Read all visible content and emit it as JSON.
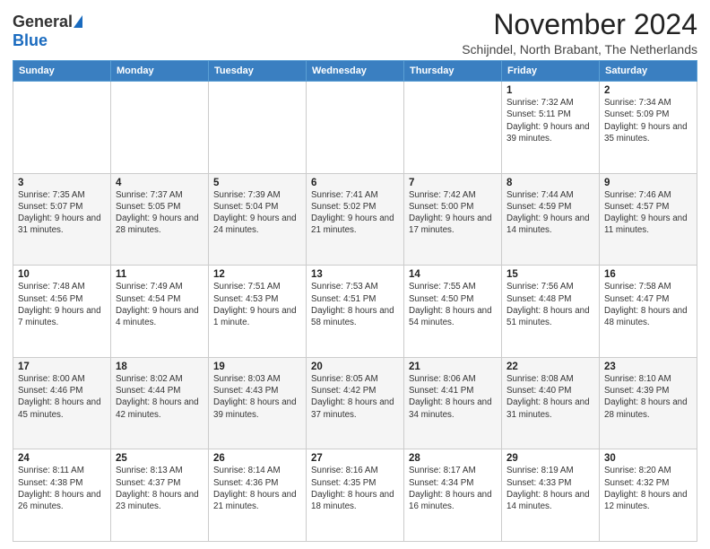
{
  "logo": {
    "general": "General",
    "blue": "Blue"
  },
  "header": {
    "month": "November 2024",
    "location": "Schijndel, North Brabant, The Netherlands"
  },
  "weekdays": [
    "Sunday",
    "Monday",
    "Tuesday",
    "Wednesday",
    "Thursday",
    "Friday",
    "Saturday"
  ],
  "weeks": [
    [
      {
        "day": "",
        "info": ""
      },
      {
        "day": "",
        "info": ""
      },
      {
        "day": "",
        "info": ""
      },
      {
        "day": "",
        "info": ""
      },
      {
        "day": "",
        "info": ""
      },
      {
        "day": "1",
        "info": "Sunrise: 7:32 AM\nSunset: 5:11 PM\nDaylight: 9 hours and 39 minutes."
      },
      {
        "day": "2",
        "info": "Sunrise: 7:34 AM\nSunset: 5:09 PM\nDaylight: 9 hours and 35 minutes."
      }
    ],
    [
      {
        "day": "3",
        "info": "Sunrise: 7:35 AM\nSunset: 5:07 PM\nDaylight: 9 hours and 31 minutes."
      },
      {
        "day": "4",
        "info": "Sunrise: 7:37 AM\nSunset: 5:05 PM\nDaylight: 9 hours and 28 minutes."
      },
      {
        "day": "5",
        "info": "Sunrise: 7:39 AM\nSunset: 5:04 PM\nDaylight: 9 hours and 24 minutes."
      },
      {
        "day": "6",
        "info": "Sunrise: 7:41 AM\nSunset: 5:02 PM\nDaylight: 9 hours and 21 minutes."
      },
      {
        "day": "7",
        "info": "Sunrise: 7:42 AM\nSunset: 5:00 PM\nDaylight: 9 hours and 17 minutes."
      },
      {
        "day": "8",
        "info": "Sunrise: 7:44 AM\nSunset: 4:59 PM\nDaylight: 9 hours and 14 minutes."
      },
      {
        "day": "9",
        "info": "Sunrise: 7:46 AM\nSunset: 4:57 PM\nDaylight: 9 hours and 11 minutes."
      }
    ],
    [
      {
        "day": "10",
        "info": "Sunrise: 7:48 AM\nSunset: 4:56 PM\nDaylight: 9 hours and 7 minutes."
      },
      {
        "day": "11",
        "info": "Sunrise: 7:49 AM\nSunset: 4:54 PM\nDaylight: 9 hours and 4 minutes."
      },
      {
        "day": "12",
        "info": "Sunrise: 7:51 AM\nSunset: 4:53 PM\nDaylight: 9 hours and 1 minute."
      },
      {
        "day": "13",
        "info": "Sunrise: 7:53 AM\nSunset: 4:51 PM\nDaylight: 8 hours and 58 minutes."
      },
      {
        "day": "14",
        "info": "Sunrise: 7:55 AM\nSunset: 4:50 PM\nDaylight: 8 hours and 54 minutes."
      },
      {
        "day": "15",
        "info": "Sunrise: 7:56 AM\nSunset: 4:48 PM\nDaylight: 8 hours and 51 minutes."
      },
      {
        "day": "16",
        "info": "Sunrise: 7:58 AM\nSunset: 4:47 PM\nDaylight: 8 hours and 48 minutes."
      }
    ],
    [
      {
        "day": "17",
        "info": "Sunrise: 8:00 AM\nSunset: 4:46 PM\nDaylight: 8 hours and 45 minutes."
      },
      {
        "day": "18",
        "info": "Sunrise: 8:02 AM\nSunset: 4:44 PM\nDaylight: 8 hours and 42 minutes."
      },
      {
        "day": "19",
        "info": "Sunrise: 8:03 AM\nSunset: 4:43 PM\nDaylight: 8 hours and 39 minutes."
      },
      {
        "day": "20",
        "info": "Sunrise: 8:05 AM\nSunset: 4:42 PM\nDaylight: 8 hours and 37 minutes."
      },
      {
        "day": "21",
        "info": "Sunrise: 8:06 AM\nSunset: 4:41 PM\nDaylight: 8 hours and 34 minutes."
      },
      {
        "day": "22",
        "info": "Sunrise: 8:08 AM\nSunset: 4:40 PM\nDaylight: 8 hours and 31 minutes."
      },
      {
        "day": "23",
        "info": "Sunrise: 8:10 AM\nSunset: 4:39 PM\nDaylight: 8 hours and 28 minutes."
      }
    ],
    [
      {
        "day": "24",
        "info": "Sunrise: 8:11 AM\nSunset: 4:38 PM\nDaylight: 8 hours and 26 minutes."
      },
      {
        "day": "25",
        "info": "Sunrise: 8:13 AM\nSunset: 4:37 PM\nDaylight: 8 hours and 23 minutes."
      },
      {
        "day": "26",
        "info": "Sunrise: 8:14 AM\nSunset: 4:36 PM\nDaylight: 8 hours and 21 minutes."
      },
      {
        "day": "27",
        "info": "Sunrise: 8:16 AM\nSunset: 4:35 PM\nDaylight: 8 hours and 18 minutes."
      },
      {
        "day": "28",
        "info": "Sunrise: 8:17 AM\nSunset: 4:34 PM\nDaylight: 8 hours and 16 minutes."
      },
      {
        "day": "29",
        "info": "Sunrise: 8:19 AM\nSunset: 4:33 PM\nDaylight: 8 hours and 14 minutes."
      },
      {
        "day": "30",
        "info": "Sunrise: 8:20 AM\nSunset: 4:32 PM\nDaylight: 8 hours and 12 minutes."
      }
    ]
  ]
}
